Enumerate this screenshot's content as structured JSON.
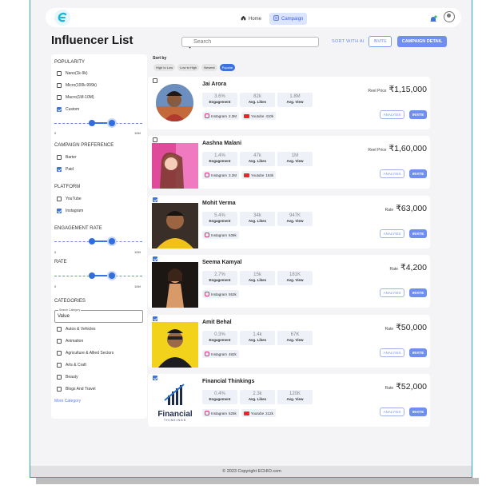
{
  "nav": {
    "home": "Home",
    "campaign": "Campaign"
  },
  "page": {
    "title": "Influencer List"
  },
  "search": {
    "placeholder": "Search"
  },
  "actions": {
    "sort_ai": "SORT WITH AI",
    "invite": "INVITE",
    "campaign_detail": "CAMPAIGN DETAIL"
  },
  "filters": {
    "popularity": {
      "title": "POPULARITY",
      "options": [
        {
          "label": "Nano(1k-9k)",
          "checked": false
        },
        {
          "label": "Micro(100k-999k)",
          "checked": false
        },
        {
          "label": "Macro(1M-10M)",
          "checked": false
        },
        {
          "label": "Custom",
          "checked": true
        }
      ],
      "min_label": "0",
      "max_label": "10M"
    },
    "campaign_pref": {
      "title": "CAMPAIGN PREFERENCE",
      "options": [
        {
          "label": "Barter",
          "checked": false
        },
        {
          "label": "Paid",
          "checked": true
        }
      ]
    },
    "platform": {
      "title": "PLATFORM",
      "options": [
        {
          "label": "YouTube",
          "checked": false
        },
        {
          "label": "Instagram",
          "checked": true
        }
      ]
    },
    "engagement": {
      "title": "ENGAGEMENT RATE",
      "min_label": "0",
      "max_label": "10M"
    },
    "rate": {
      "title": "RATE",
      "min_label": "0",
      "max_label": "10M"
    },
    "categories": {
      "title": "CATEGORIES",
      "field_legend": "Search Category",
      "field_value": "Value",
      "options": [
        {
          "label": "Autos & Vehicles",
          "checked": false
        },
        {
          "label": "Animation",
          "checked": false
        },
        {
          "label": "Agriculture & Allied Sectors",
          "checked": false
        },
        {
          "label": "Arts & Craft",
          "checked": false
        },
        {
          "label": "Beauty",
          "checked": false
        },
        {
          "label": "Blogs And Travel",
          "checked": false
        }
      ],
      "more": "More Category"
    }
  },
  "sort": {
    "label": "Sort by",
    "chips": [
      {
        "label": "High to Low",
        "active": false
      },
      {
        "label": "Low to High",
        "active": false
      },
      {
        "label": "Newest",
        "active": false
      },
      {
        "label": "Popular",
        "active": true
      }
    ]
  },
  "card_labels": {
    "engagement": "Engagement",
    "likes": "Avg. Likes",
    "views": "Avg. View",
    "instagram": "Instagram",
    "youtube": "Youtube",
    "analysis": "ANALYSIS",
    "invite": "INVITE"
  },
  "influencers": [
    {
      "name": "Jai Arora",
      "checked": false,
      "engagement": "3.6%",
      "likes": "82k",
      "views": "1.8M",
      "instagram": "2.3M",
      "youtube": "410k",
      "price_label": "Reel Price",
      "price": "₹1,15,000"
    },
    {
      "name": "Aashna Malani",
      "checked": false,
      "engagement": "1.4%",
      "likes": "47k",
      "views": "1M",
      "instagram": "3.2M",
      "youtube": "163k",
      "price_label": "Reel Price",
      "price": "₹1,60,000"
    },
    {
      "name": "Mohit Verma",
      "checked": true,
      "engagement": "5.4%",
      "likes": "34k",
      "views": "947K",
      "instagram": "639k",
      "youtube": "",
      "price_label": "Rate",
      "price": "₹63,000"
    },
    {
      "name": "Seema Kamyal",
      "checked": true,
      "engagement": "2.7%",
      "likes": "15k",
      "views": "181K",
      "instagram": "553k",
      "youtube": "",
      "price_label": "Rate",
      "price": "₹4,200"
    },
    {
      "name": "Amit Behal",
      "checked": true,
      "engagement": "0.3%",
      "likes": "1.4k",
      "views": "67K",
      "instagram": "482k",
      "youtube": "",
      "price_label": "Rate",
      "price": "₹50,000"
    },
    {
      "name": "Financial Thinkings",
      "checked": true,
      "engagement": "0.4%",
      "likes": "2.3k",
      "views": "120K",
      "instagram": "525k",
      "youtube": "212k",
      "price_label": "Rate",
      "price": "₹52,000",
      "logo_text": "Financial",
      "logo_sub": "THINKINGS"
    }
  ],
  "footer": {
    "copyright": "© 2023 Copyright ECHIO.com"
  }
}
